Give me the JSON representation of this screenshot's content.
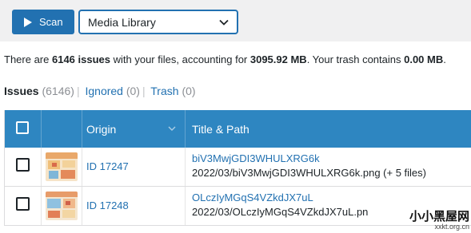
{
  "toolbar": {
    "scan_label": "Scan",
    "library_select_value": "Media Library"
  },
  "summary": {
    "prefix": "There are ",
    "issues_count": "6146 issues",
    "mid1": " with your files, accounting for ",
    "size": "3095.92 MB",
    "mid2": ". Your trash contains ",
    "trash_size": "0.00 MB",
    "suffix": "."
  },
  "filters": {
    "issues_label": "Issues",
    "issues_count": "(6146)",
    "ignored_label": "Ignored",
    "ignored_count": "(0)",
    "trash_label": "Trash",
    "trash_count": "(0)",
    "separator": "|"
  },
  "table": {
    "columns": [
      "",
      "",
      "Origin",
      "Title & Path"
    ],
    "rows": [
      {
        "origin": "ID 17247",
        "title": "biV3MwjGDI3WHULXRG6k",
        "path": "2022/03/biV3MwjGDI3WHULXRG6k.png (+ 5 files)"
      },
      {
        "origin": "ID 17248",
        "title": "OLczIyMGqS4VZkdJX7uL",
        "path": "2022/03/OLczIyMGqS4VZkdJX7uL.pn"
      }
    ]
  },
  "watermark": {
    "line1": "小小黑屋网",
    "line2": "xxkt.org.cn"
  },
  "colors": {
    "accent": "#2271b1",
    "header_bg": "#2e86c1",
    "topbar_bg": "#f0f0f1"
  }
}
